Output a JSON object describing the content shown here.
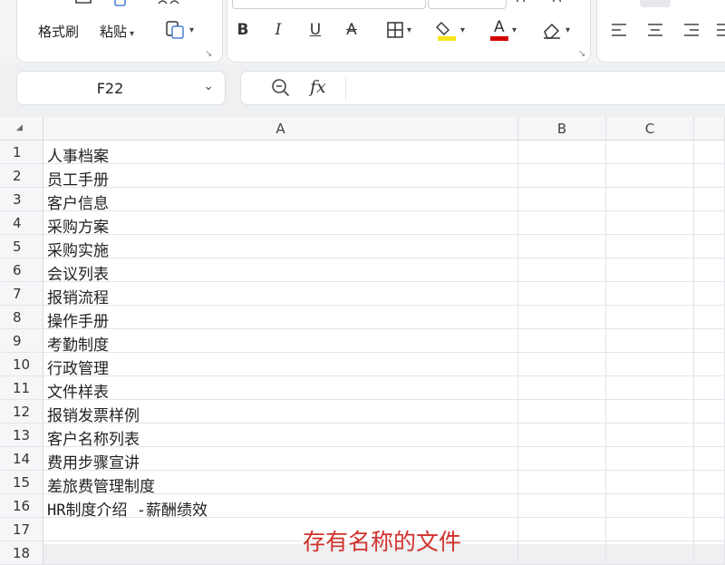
{
  "toolbar": {
    "format_painter": "格式刷",
    "paste": "粘贴",
    "bold": "B",
    "italic": "I",
    "underline": "U",
    "strikethrough": "A",
    "font_color_letter": "A"
  },
  "formula_bar": {
    "cell_ref": "F22",
    "fx": "fx",
    "value": ""
  },
  "sheet": {
    "columns": [
      "A",
      "B",
      "C"
    ],
    "rows": [
      {
        "num": "1",
        "a": "人事档案"
      },
      {
        "num": "2",
        "a": "员工手册"
      },
      {
        "num": "3",
        "a": "客户信息"
      },
      {
        "num": "4",
        "a": "采购方案"
      },
      {
        "num": "5",
        "a": "采购实施"
      },
      {
        "num": "6",
        "a": "会议列表"
      },
      {
        "num": "7",
        "a": "报销流程"
      },
      {
        "num": "8",
        "a": "操作手册"
      },
      {
        "num": "9",
        "a": "考勤制度"
      },
      {
        "num": "10",
        "a": "行政管理"
      },
      {
        "num": "11",
        "a": "文件样表"
      },
      {
        "num": "12",
        "a": "报销发票样例"
      },
      {
        "num": "13",
        "a": "客户名称列表"
      },
      {
        "num": "14",
        "a": "费用步骤宣讲"
      },
      {
        "num": "15",
        "a": "差旅费管理制度"
      },
      {
        "num": "16",
        "a": "HR制度介绍 -薪酬绩效"
      },
      {
        "num": "17",
        "a": ""
      },
      {
        "num": "18",
        "a": ""
      }
    ]
  },
  "overlay_caption": "存有名称的文件",
  "colors": {
    "accent_red": "#d0322d",
    "highlight_yellow": "#f5e51a",
    "font_red": "#d40000"
  }
}
